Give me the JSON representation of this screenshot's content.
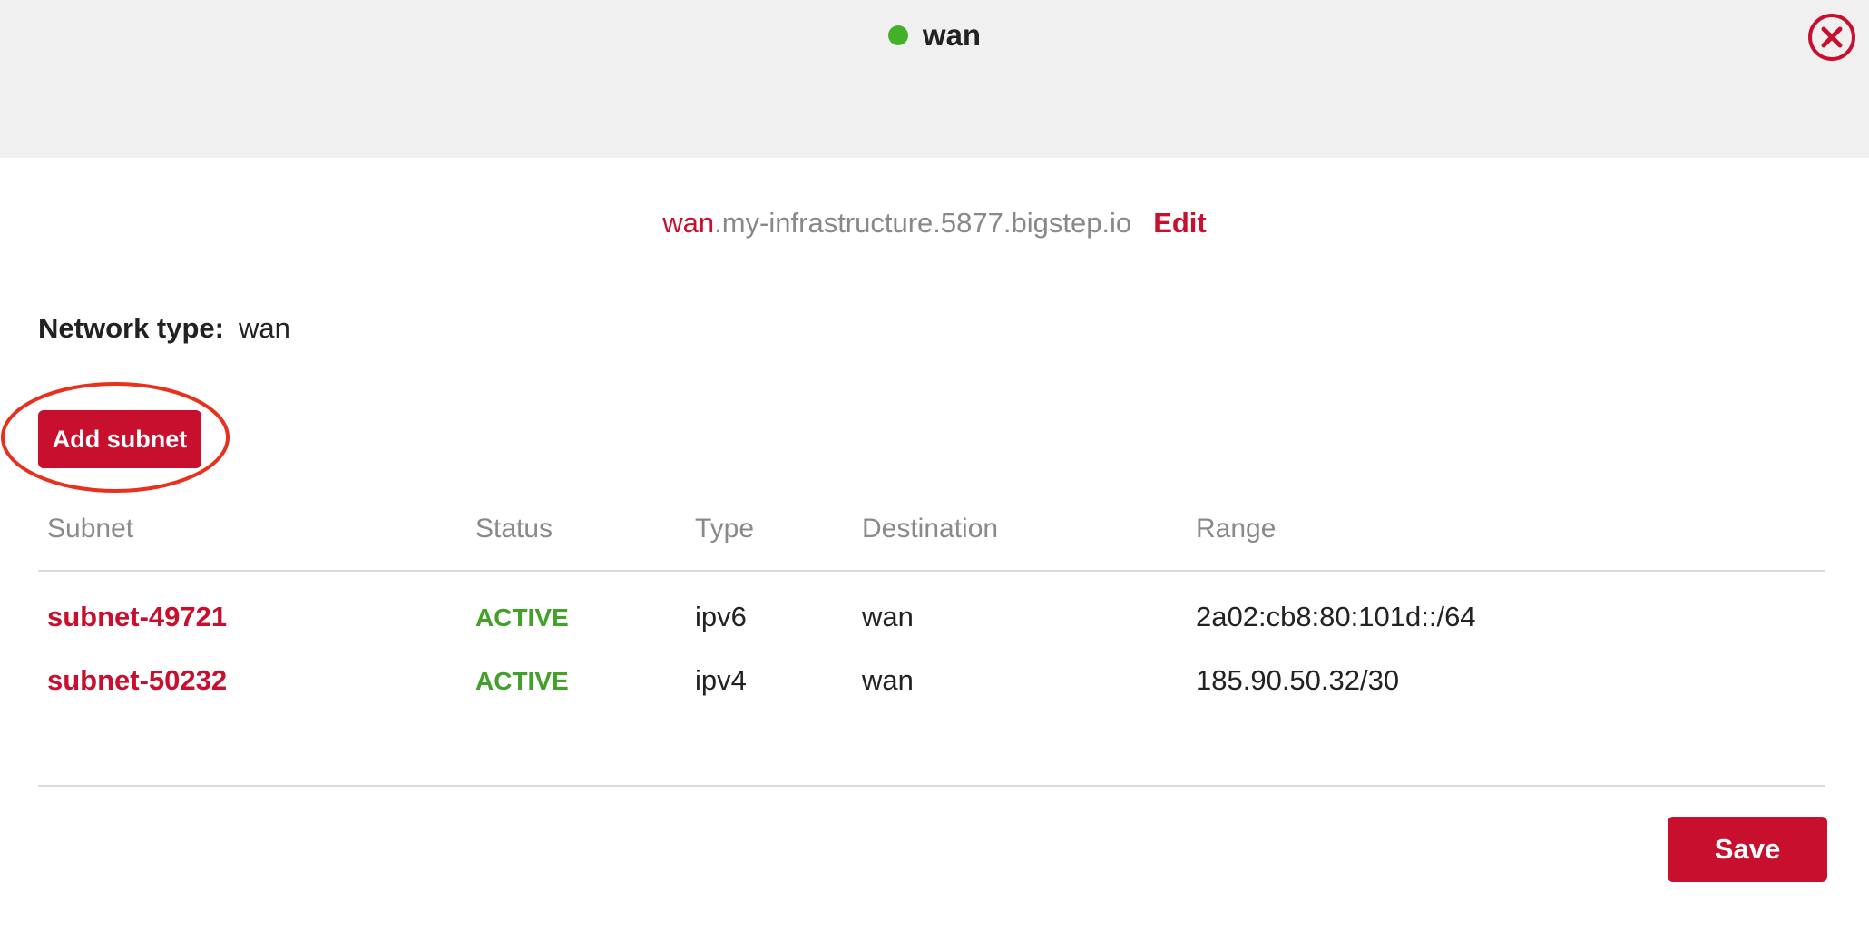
{
  "header": {
    "title": "wan",
    "status_color": "#43b02a",
    "close_icon": "close-circle-icon"
  },
  "hostname": {
    "prefix": "wan",
    "suffix": ".my-infrastructure.5877.bigstep.io",
    "edit_label": "Edit"
  },
  "network": {
    "type_label": "Network type:",
    "type_value": "wan"
  },
  "actions": {
    "add_subnet_label": "Add subnet",
    "save_label": "Save"
  },
  "table": {
    "columns": [
      "Subnet",
      "Status",
      "Type",
      "Destination",
      "Range"
    ],
    "rows": [
      {
        "subnet": "subnet-49721",
        "status": "ACTIVE",
        "type": "ipv6",
        "destination": "wan",
        "range": "2a02:cb8:80:101d::/64"
      },
      {
        "subnet": "subnet-50232",
        "status": "ACTIVE",
        "type": "ipv4",
        "destination": "wan",
        "range": "185.90.50.32/30"
      }
    ]
  },
  "colors": {
    "accent": "#c8102e",
    "active": "#43a02a",
    "header_bg": "#f0f0f0"
  }
}
